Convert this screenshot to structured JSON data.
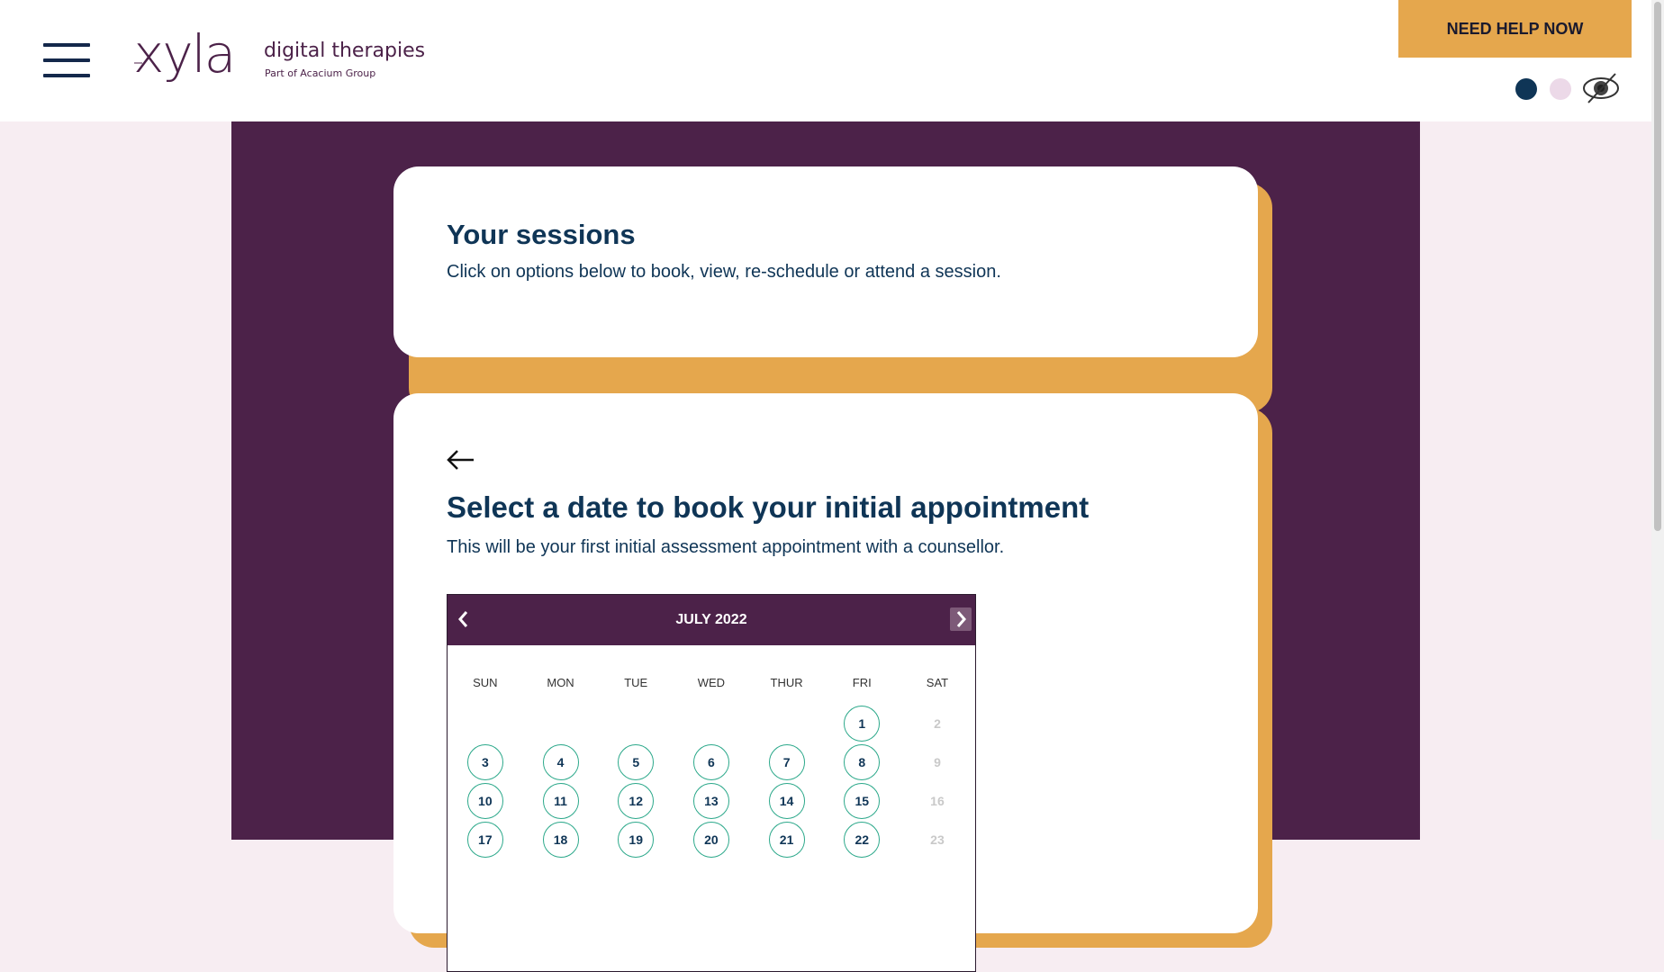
{
  "header": {
    "menu_icon": "hamburger-menu-icon",
    "logo": {
      "wordmark": "xyla",
      "tagline": "digital therapies",
      "subline": "Part of Acacium Group"
    },
    "help_button_label": "NEED HELP NOW",
    "contrast_options": [
      {
        "name": "dark-theme",
        "color": "#0f3556"
      },
      {
        "name": "light-theme",
        "color": "#ecd9e8"
      }
    ],
    "visibility_icon": "eye-slash-icon"
  },
  "sessions_card": {
    "title": "Your sessions",
    "text": "Click on options below to book, view, re-schedule or attend a session."
  },
  "booking_card": {
    "back_icon": "arrow-left-icon",
    "title": "Select a date to book your initial appointment",
    "text": "This will be your first initial assessment appointment with a counsellor."
  },
  "calendar": {
    "month_label": "JULY 2022",
    "prev_icon": "chevron-left-icon",
    "next_icon": "chevron-right-icon",
    "weekdays": [
      "SUN",
      "MON",
      "TUE",
      "WED",
      "THUR",
      "FRI",
      "SAT"
    ],
    "weeks": [
      [
        null,
        null,
        null,
        null,
        null,
        {
          "day": "1",
          "available": true
        },
        {
          "day": "2",
          "available": false
        }
      ],
      [
        {
          "day": "3",
          "available": true
        },
        {
          "day": "4",
          "available": true
        },
        {
          "day": "5",
          "available": true
        },
        {
          "day": "6",
          "available": true
        },
        {
          "day": "7",
          "available": true
        },
        {
          "day": "8",
          "available": true
        },
        {
          "day": "9",
          "available": false
        }
      ],
      [
        {
          "day": "10",
          "available": true
        },
        {
          "day": "11",
          "available": true
        },
        {
          "day": "12",
          "available": true
        },
        {
          "day": "13",
          "available": true
        },
        {
          "day": "14",
          "available": true
        },
        {
          "day": "15",
          "available": true
        },
        {
          "day": "16",
          "available": false
        }
      ],
      [
        {
          "day": "17",
          "available": true
        },
        {
          "day": "18",
          "available": true
        },
        {
          "day": "19",
          "available": true
        },
        {
          "day": "20",
          "available": true
        },
        {
          "day": "21",
          "available": true
        },
        {
          "day": "22",
          "available": true
        },
        {
          "day": "23",
          "available": false
        }
      ]
    ]
  },
  "colors": {
    "brand_purple": "#4c2249",
    "accent_gold": "#e5a74d",
    "navy_text": "#0f3556",
    "available_ring": "#2ba88a",
    "page_background": "#f7edf2"
  }
}
